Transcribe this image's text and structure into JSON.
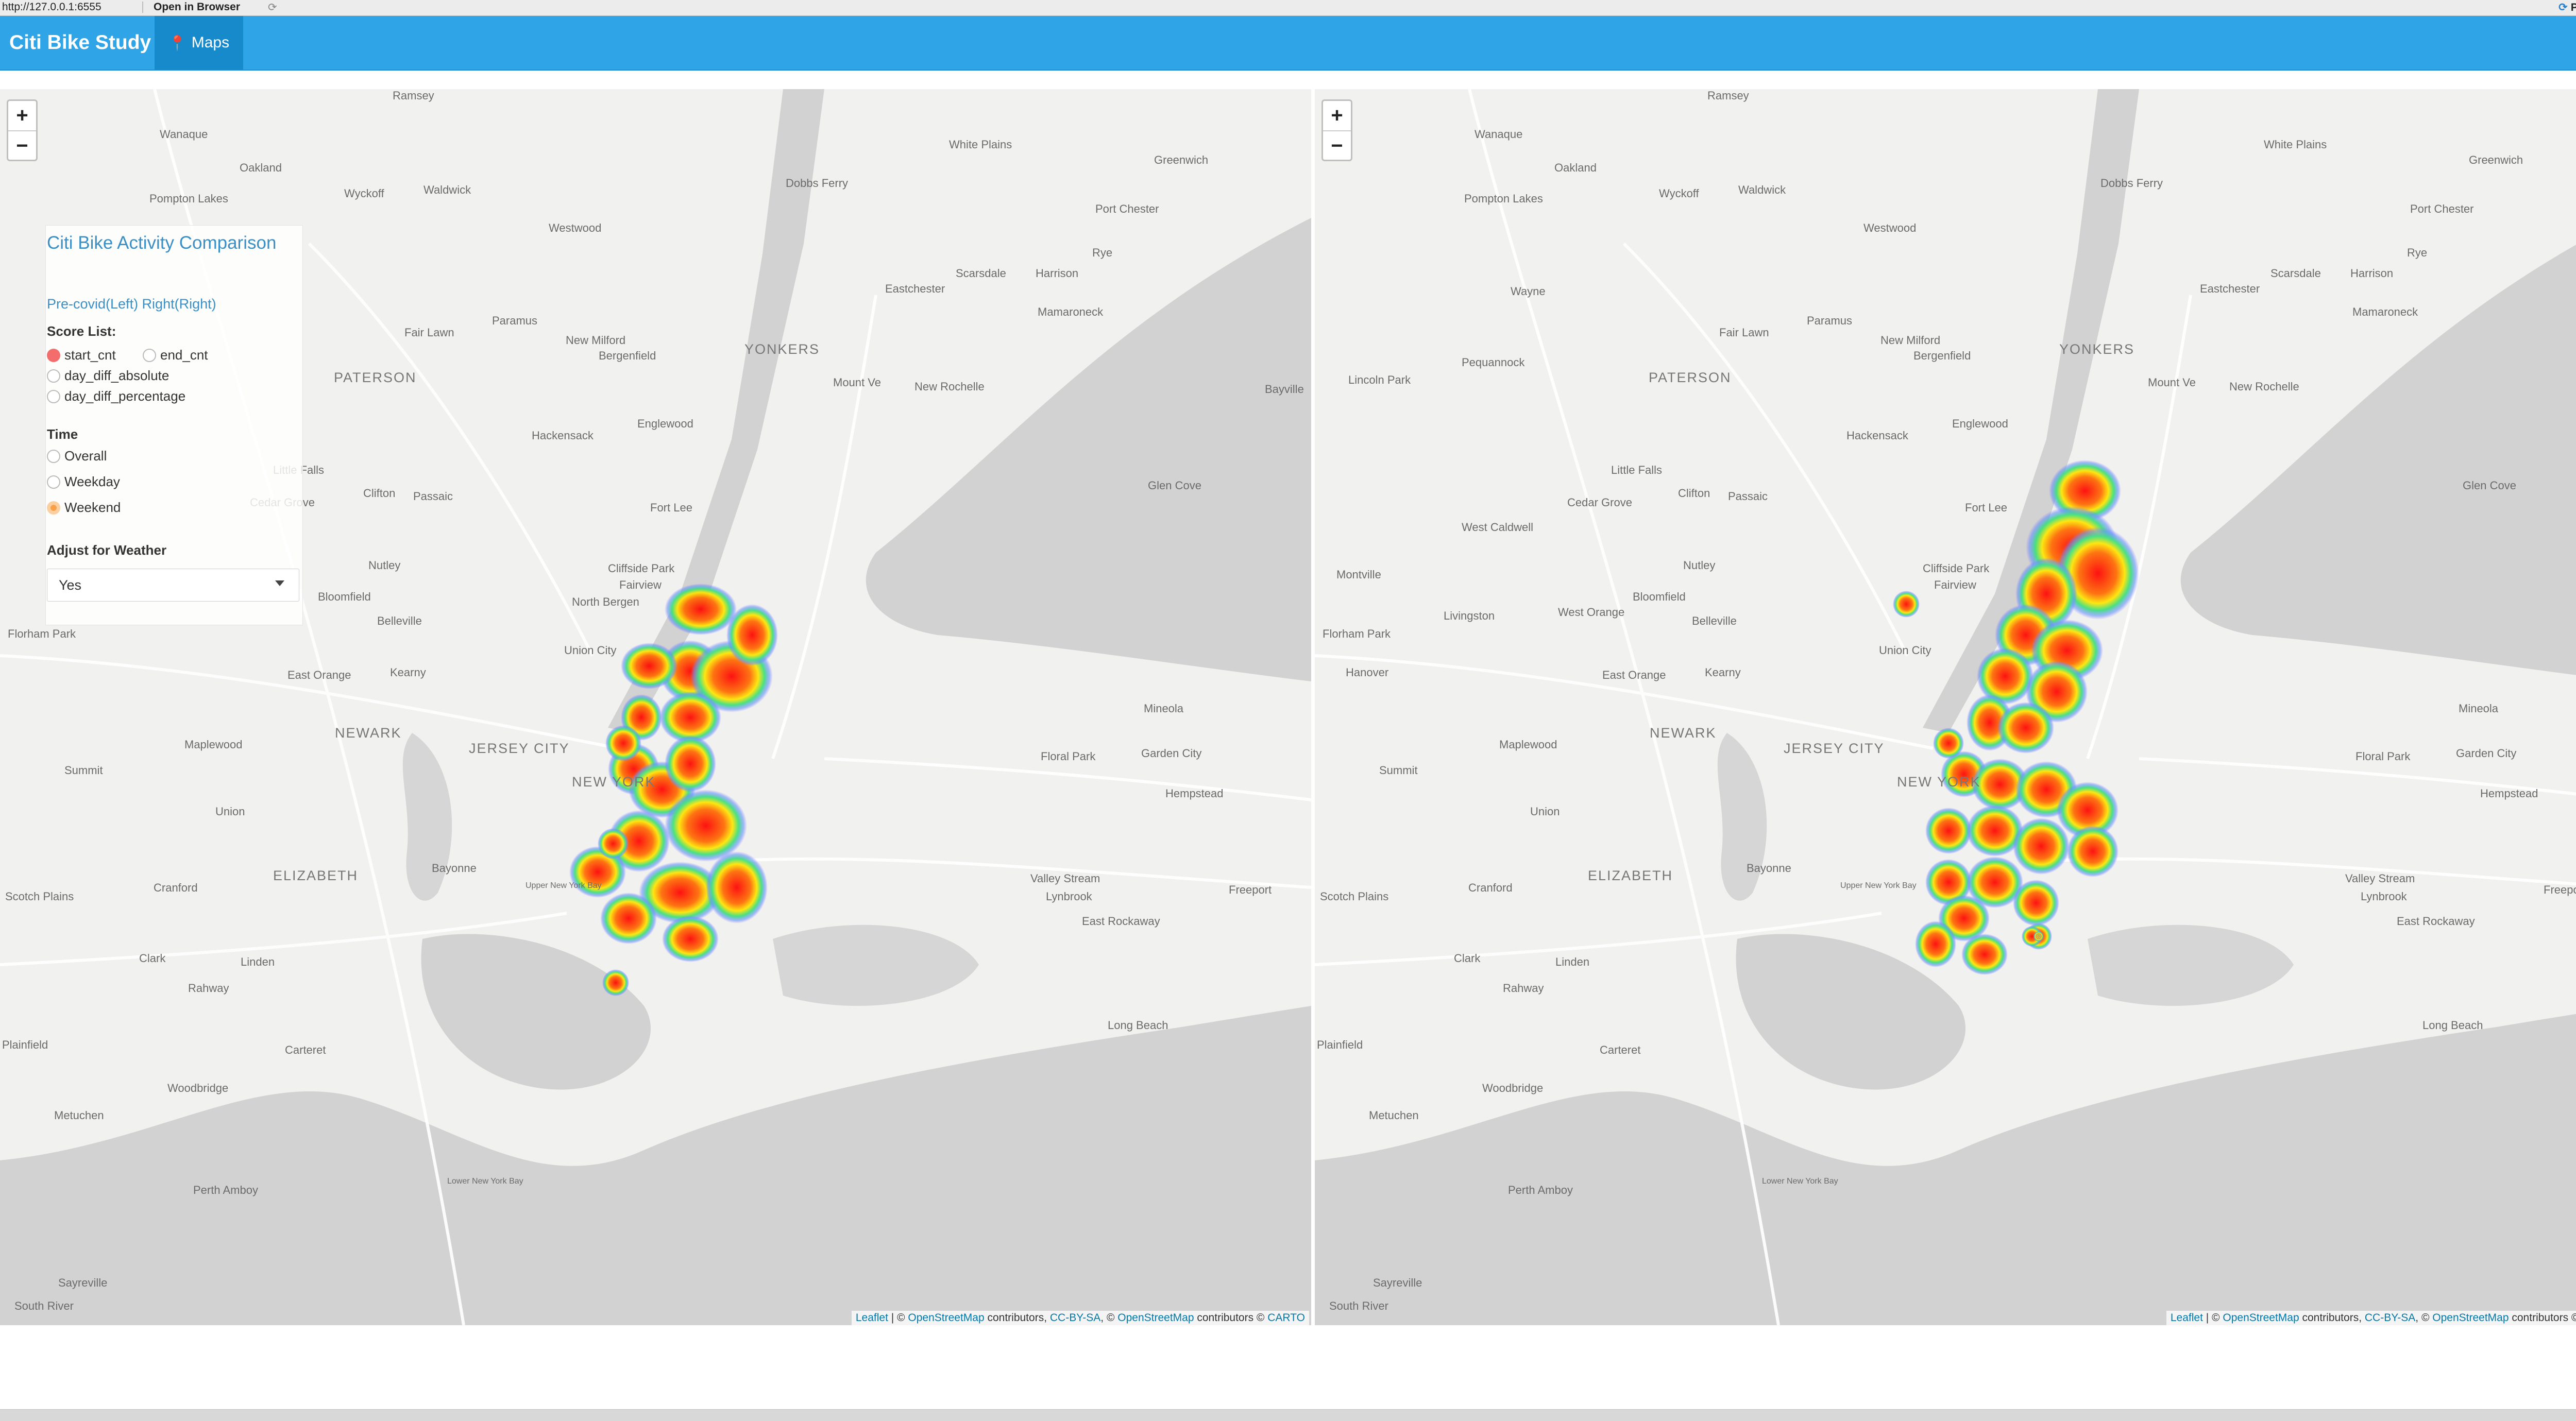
{
  "browser": {
    "url": "http://127.0.0.1:6555",
    "open_in_browser": "Open in Browser",
    "publish": "Publish"
  },
  "navbar": {
    "brand": "Citi Bike Study",
    "tabs": [
      {
        "label": "Maps",
        "icon": "map-marker-icon"
      }
    ]
  },
  "controls": {
    "title": "Citi Bike Activity Comparison",
    "subtitle": "Pre-covid(Left) Right(Right)",
    "score_list": {
      "label": "Score List:",
      "options": [
        "start_cnt",
        "end_cnt",
        "day_diff_absolute",
        "day_diff_percentage"
      ],
      "selected": "start_cnt"
    },
    "time": {
      "label": "Time",
      "options": [
        "Overall",
        "Weekday",
        "Weekend"
      ],
      "selected": "Weekend"
    },
    "weather": {
      "label": "Adjust for Weather",
      "selected": "Yes"
    }
  },
  "maps": {
    "zoom_in": "+",
    "zoom_out": "−",
    "attribution": {
      "leaflet": "Leaflet",
      "sep1": " | © ",
      "osm": "OpenStreetMap",
      "contributors": " contributors, ",
      "ccbysa": "CC-BY-SA",
      "sep2": ", © ",
      "osm2": "OpenStreetMap",
      "contributors2": " contributors © ",
      "carto": "CARTO"
    },
    "labels": [
      "Ramsey",
      "Wanaque",
      "Oakland",
      "Pompton Lakes",
      "Wyckoff",
      "Waldwick",
      "White Plains",
      "Greenwich",
      "Dobbs Ferry",
      "Port Chester",
      "Rye",
      "Westwood",
      "Scarsdale",
      "Harrison",
      "Eastchester",
      "Mamaroneck",
      "Paramus",
      "Fair Lawn",
      "New Milford",
      "Bergenfield",
      "YONKERS",
      "PATERSON",
      "Mount Ve",
      "New Rochelle",
      "Bayville",
      "Hackensack",
      "Englewood",
      "Little Falls",
      "Clifton",
      "Passaic",
      "Fort Lee",
      "Glen Cove",
      "Cedar Grove",
      "Nutley",
      "Cliffside Park",
      "Fairview",
      "North Bergen",
      "Bloomfield",
      "Belleville",
      "Florham Park",
      "Union City",
      "East Orange",
      "Kearny",
      "NEWARK",
      "Mineola",
      "Maplewood",
      "JERSEY CITY",
      "Floral Park",
      "Garden City",
      "Summit",
      "NEW YORK",
      "Hempstead",
      "Union",
      "ELIZABETH",
      "Bayonne",
      "Scotch Plains",
      "Cranford",
      "Valley Stream",
      "Freeport",
      "Lynbrook",
      "East Rockaway",
      "Clark",
      "Linden",
      "Rahway",
      "Long Beach",
      "Plainfield",
      "Carteret",
      "Woodbridge",
      "Metuchen",
      "Perth Amboy",
      "Sayreville",
      "South River",
      "Upper New York Bay",
      "Lower New York Bay",
      "West Caldwell",
      "Livingston",
      "West Orange",
      "Hanover",
      "Montville",
      "Lincoln Park",
      "Pequannock",
      "Wayne"
    ]
  }
}
